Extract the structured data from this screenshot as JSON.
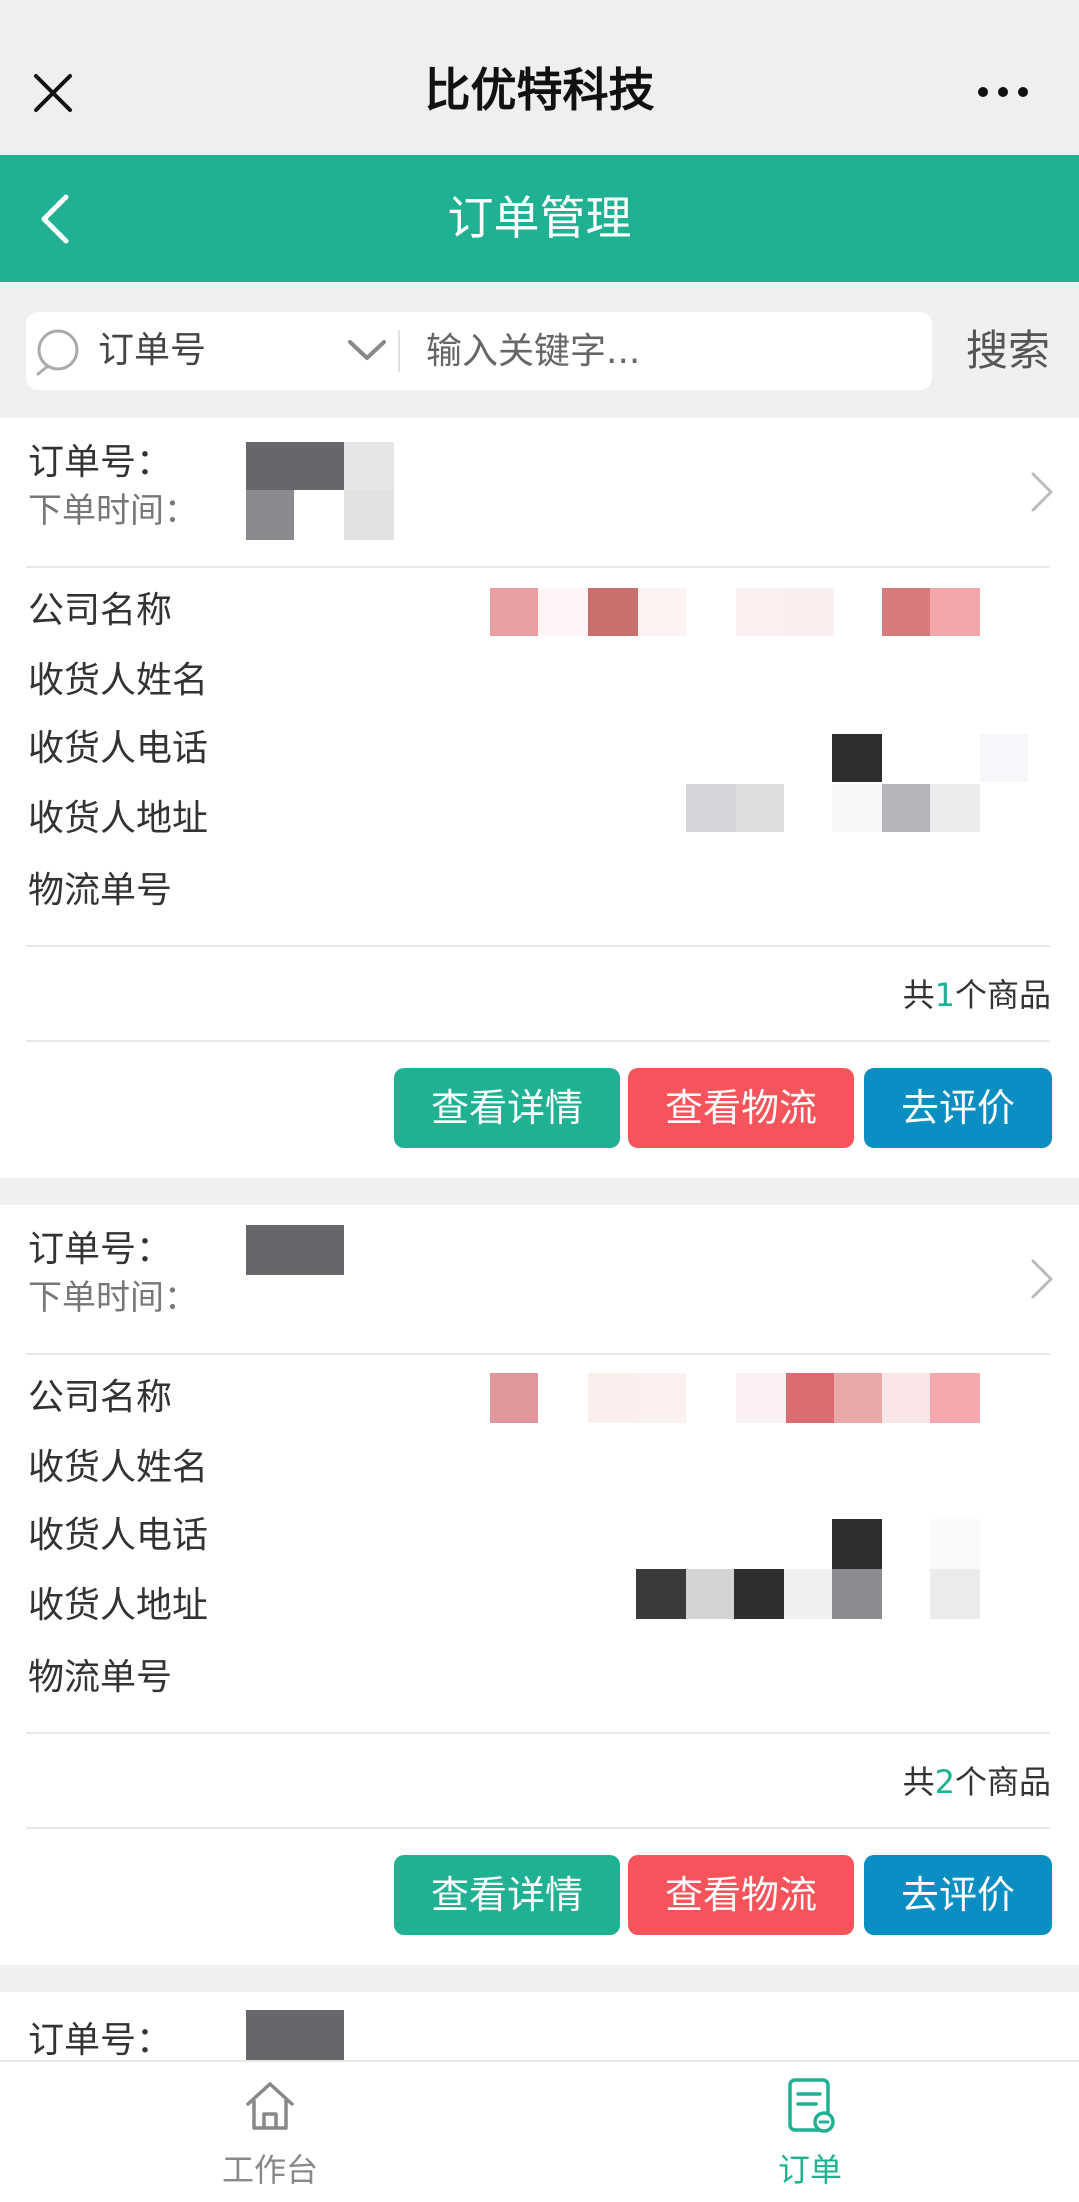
{
  "topbar": {
    "title": "比优特科技"
  },
  "header": {
    "title": "订单管理"
  },
  "search": {
    "field_label": "订单号",
    "placeholder": "输入关键字...",
    "button_label": "搜索"
  },
  "labels": {
    "order_no": "订单号：",
    "order_time": "下单时间：",
    "company": "公司名称",
    "consignee_name": "收货人姓名",
    "consignee_phone": "收货人电话",
    "consignee_address": "收货人地址",
    "tracking_no": "物流单号",
    "count_prefix": "共",
    "count_suffix": "个商品"
  },
  "buttons": {
    "detail": "查看详情",
    "logistics": "查看物流",
    "review": "去评价"
  },
  "orders": [
    {
      "item_count": "1"
    },
    {
      "item_count": "2"
    },
    {
      "item_count": ""
    }
  ],
  "bottom_nav": {
    "workbench": "工作台",
    "orders": "订单"
  },
  "colors": {
    "accent": "#1fb192",
    "danger": "#f4545a",
    "info": "#0b8ec2"
  }
}
